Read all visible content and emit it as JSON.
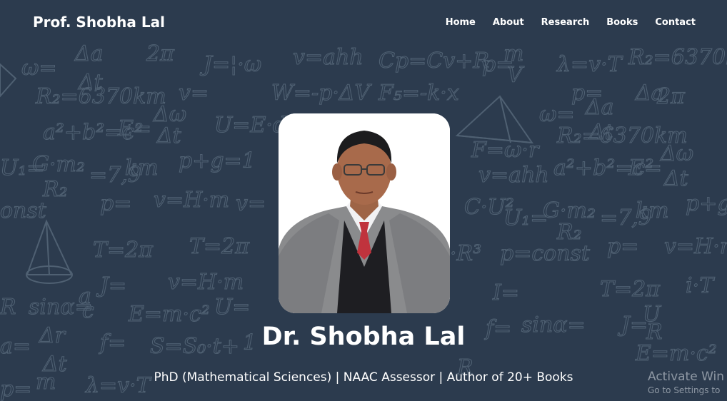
{
  "header": {
    "brand": "Prof. Shobha Lal",
    "nav": [
      {
        "label": "Home"
      },
      {
        "label": "About"
      },
      {
        "label": "Research"
      },
      {
        "label": "Books"
      },
      {
        "label": "Contact"
      }
    ]
  },
  "hero": {
    "name": "Dr. Shobha Lal",
    "tagline": "PhD (Mathematical Sciences) | NAAC Assessor | Author of 20+ Books"
  },
  "watermark": {
    "title": "Activate Win",
    "subtitle": "Go to Settings to"
  },
  "colors": {
    "background": "#2c3b4e",
    "navbar": "#2c3b4e",
    "text": "#ffffff",
    "doodle": "#4f6072",
    "tie": "#c0333d",
    "suit": "#8a8b8d"
  },
  "icons": {
    "background": "math-formulas-chalkboard",
    "portrait": "professor-portrait"
  }
}
